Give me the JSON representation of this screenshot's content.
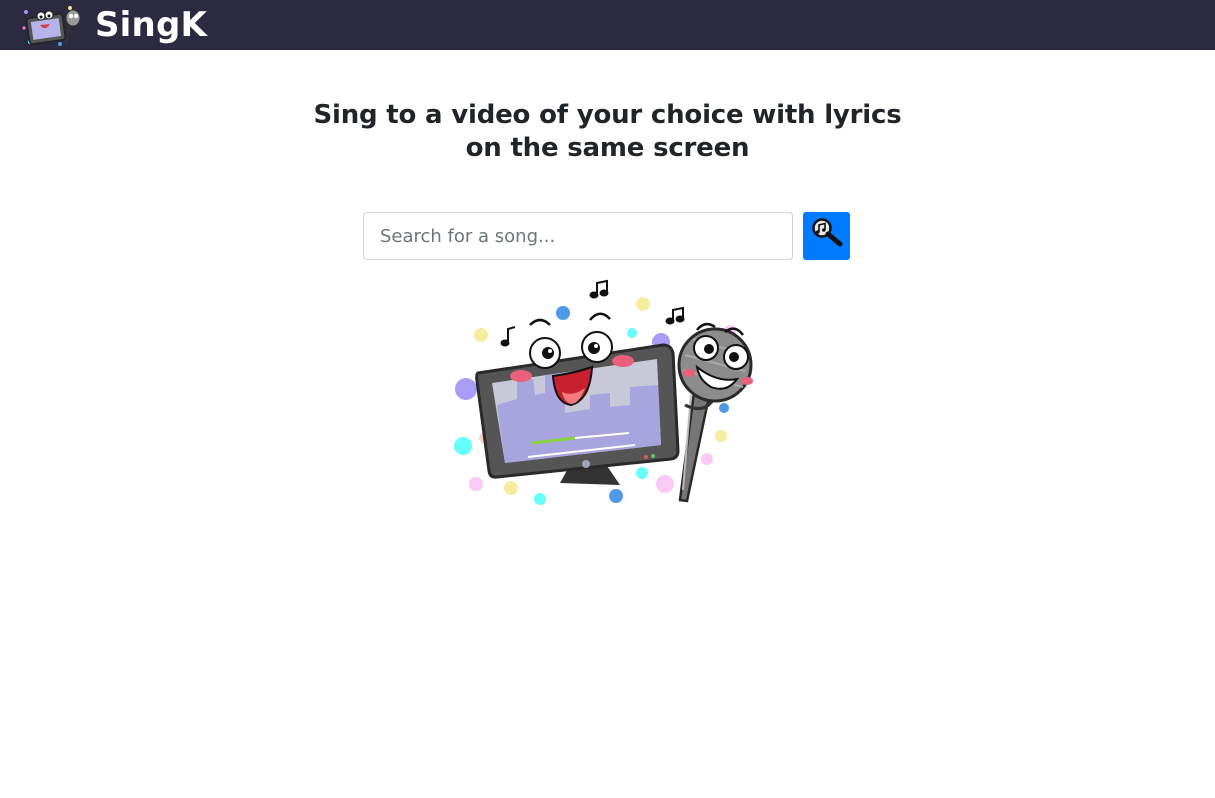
{
  "app": {
    "brand_name": "SingK",
    "logo_icon": "karaoke-tv-mic-logo"
  },
  "hero": {
    "line1": "Sing to a video of your choice with lyrics",
    "line2": "on the same screen"
  },
  "search": {
    "placeholder": "Search for a song...",
    "value": "",
    "button_icon": "music-search-magnifier-icon"
  },
  "illustration": {
    "name": "karaoke-tv-and-microphone-mascot"
  },
  "colors": {
    "navbar": "#2b2a40",
    "accent": "#007bff"
  }
}
